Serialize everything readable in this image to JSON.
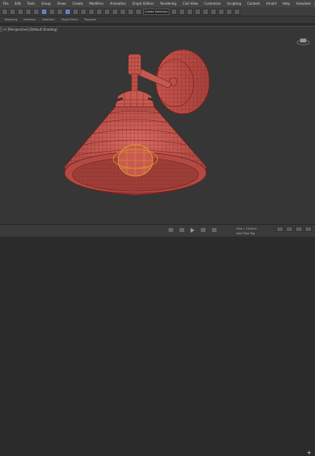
{
  "menubar": {
    "items": [
      "File",
      "Edit",
      "Tools",
      "Group",
      "Views",
      "Create",
      "Modifiers",
      "Animation",
      "Graph Editors",
      "Rendering",
      "Civil View",
      "Customize",
      "Scripting",
      "Content",
      "Arnold",
      "Help",
      "Autodesk"
    ]
  },
  "toolbar": {
    "select_dropdown": "Create Selection Se"
  },
  "ribbon": {
    "tabs": [
      "Modeling",
      "Freeform",
      "Selection",
      "Object Paint",
      "Populate"
    ]
  },
  "viewport": {
    "label": "[+] [Perspective] [Default Shading]"
  },
  "statusbar": {
    "grid": "Grid = 10.0cm",
    "tag": "Add Time Tag"
  },
  "colors": {
    "model_fill": "#c85a52",
    "model_wire": "#6e1e1a",
    "selection": "#e0a020"
  }
}
